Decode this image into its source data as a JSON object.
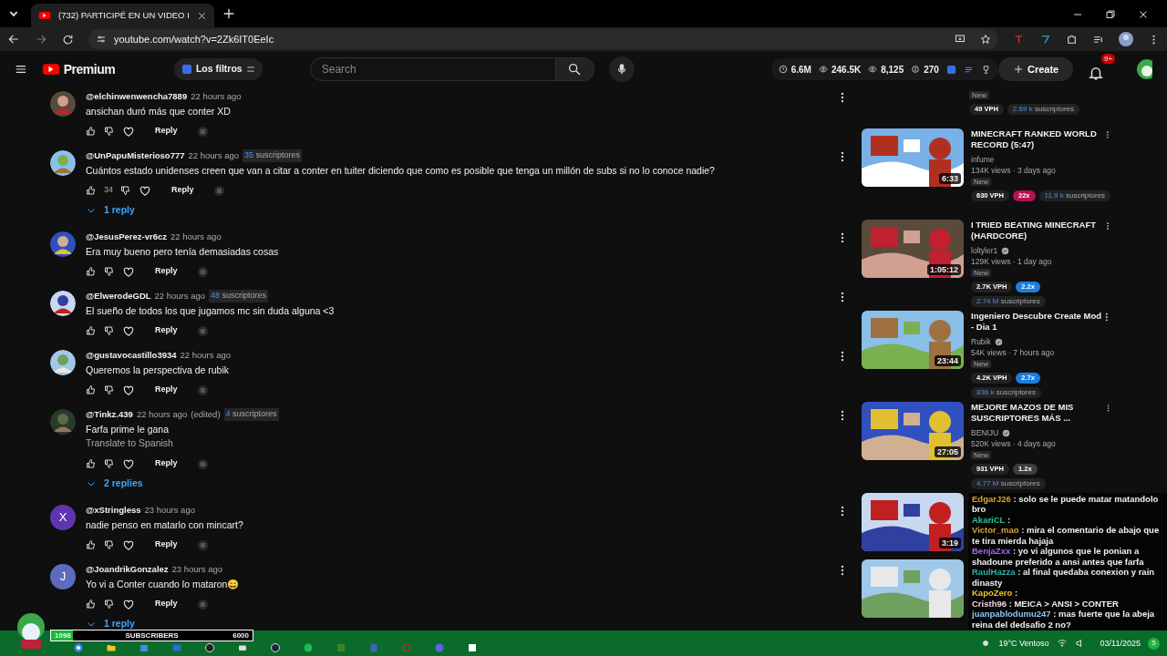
{
  "browser": {
    "tab_title": "(732) PARTICIPÉ EN UN VIDEO I",
    "url": "youtube.com/watch?v=2Zk6IT0EeIc"
  },
  "header": {
    "logo": "Premium",
    "filter_chip": "Los filtros",
    "search": {
      "placeholder": "Search"
    },
    "stats": [
      {
        "kind": "clock",
        "value": "6.6M"
      },
      {
        "kind": "views",
        "value": "246.5K"
      },
      {
        "kind": "views",
        "value": "8,125"
      },
      {
        "kind": "money",
        "value": "270"
      }
    ],
    "create": "Create",
    "notifications": "9+"
  },
  "comments": [
    {
      "author": "@elchinwenwencha7889",
      "time": "22 hours ago",
      "text": "ansichan duró más que conter XD",
      "reply_label": "Reply"
    },
    {
      "author": "@UnPapuMisterioso777",
      "time": "22 hours ago",
      "subscribers": {
        "count": "35",
        "label": "suscriptores"
      },
      "text": "Cuántos estado unidenses creen que van a citar a conter en tuiter diciendo que como es posible que tenga un millón de subs si no lo conoce nadie?",
      "likes": "34",
      "reply_label": "Reply",
      "replies": "1 reply"
    },
    {
      "author": "@JesusPerez-vr6cz",
      "time": "22 hours ago",
      "text": "Era muy bueno pero tenía demasiadas cosas",
      "reply_label": "Reply"
    },
    {
      "author": "@ElwerodeGDL",
      "time": "22 hours ago",
      "subscribers": {
        "count": "48",
        "label": "suscriptores"
      },
      "text": "El sueño de todos los que jugamos mc sin duda alguna <3",
      "reply_label": "Reply"
    },
    {
      "author": "@gustavocastillo3934",
      "time": "22 hours ago",
      "text": "Queremos la perspectiva de rubik",
      "reply_label": "Reply"
    },
    {
      "author": "@Tinkz.439",
      "time": "22 hours ago",
      "edited_label": "(edited)",
      "subscribers": {
        "count": "4",
        "label": "suscriptores"
      },
      "text": "Farfa prime le gana",
      "translate": "Translate to Spanish",
      "reply_label": "Reply",
      "replies": "2 replies"
    },
    {
      "author": "@xStringless",
      "time": "23 hours ago",
      "text": "nadie penso en matarlo con mincart?",
      "reply_label": "Reply",
      "avatar": {
        "kind": "letter",
        "letter": "X",
        "color": "#5e35b1"
      }
    },
    {
      "author": "@JoandrikGonzalez",
      "time": "23 hours ago",
      "text": "Yo vi a Conter cuando lo mataron😄",
      "reply_label": "Reply",
      "replies": "1 reply",
      "avatar": {
        "kind": "letter",
        "letter": "J",
        "color": "#5c6bc0"
      }
    }
  ],
  "sidebar": [
    {
      "kind": "partial",
      "new_label": "New",
      "vph": "49 VPH",
      "subs": {
        "count": "2.69 k",
        "label": "suscriptores"
      }
    },
    {
      "kind": "video",
      "title": "MINECRAFT RANKED WORLD RECORD (5:47)",
      "channel": "infume",
      "verified": false,
      "meta": "134K views · 3 days ago",
      "duration": "6:33",
      "new_label": "New",
      "vph": "630 VPH",
      "multiplier": {
        "text": "22x",
        "color": "#b0134f"
      },
      "subs": {
        "count": "11.9 k",
        "label": "suscriptores"
      }
    },
    {
      "kind": "video",
      "title": "I TRIED BEATING MINECRAFT (HARDCORE)",
      "channel": "loltyler1",
      "verified": true,
      "meta": "129K views · 1 day ago",
      "duration": "1:05:12",
      "new_label": "New",
      "vph": "2.7K VPH",
      "multiplier": {
        "text": "2.2x",
        "color": "#1c7ee0"
      },
      "subs": {
        "count": "2.74 M",
        "label": "suscriptores"
      }
    },
    {
      "kind": "video",
      "title": "Ingeniero Descubre Create Mod - Dia 1",
      "channel": "Rubik",
      "verified": true,
      "meta": "54K views · 7 hours ago",
      "duration": "23:44",
      "new_label": "New",
      "vph": "4.2K VPH",
      "multiplier": {
        "text": "2.7x",
        "color": "#1c7ee0"
      },
      "subs": {
        "count": "836 k",
        "label": "suscriptores"
      }
    },
    {
      "kind": "video",
      "title": "MEJORE MAZOS DE MIS SUSCRIPTORES MÁS ...",
      "channel": "BENIJU",
      "verified": true,
      "meta": "520K views · 4 days ago",
      "duration": "27:05",
      "new_label": "New",
      "vph": "931 VPH",
      "multiplier": {
        "text": "1.2x",
        "color": "#3d3d3d"
      },
      "subs": {
        "count": "4.77 M",
        "label": "suscriptores"
      }
    },
    {
      "kind": "covered",
      "duration": "3:19"
    },
    {
      "kind": "covered"
    }
  ],
  "chat": [
    {
      "user": "EdgarJ26",
      "color": "#e0a030",
      "text": ": solo se le puede matar matandolo bro"
    },
    {
      "user": "AkariCL",
      "color": "#2ec4a0",
      "text": ":"
    },
    {
      "user": "Victor_mao",
      "color": "#d4a63a",
      "text": ": mira el comentario de abajo que te tira mierda hajaja"
    },
    {
      "user": "BenjaZxx",
      "color": "#9b6cf0",
      "text": ": yo vi algunos que le ponian a shadoune preferido a ansi antes que farfa"
    },
    {
      "user": "RaulHazza",
      "color": "#2bb3a8",
      "text": ": al final quedaba conexion y rain dinasty"
    },
    {
      "user": "KapoZero",
      "color": "#f0c020",
      "text": ":"
    },
    {
      "user": "Cristh96",
      "color": "#f2d0e0",
      "text": ": MEICA > ANSI > CONTER"
    },
    {
      "user": "juanpablodumu247",
      "color": "#8fc7f0",
      "text": ": mas fuerte que la abeja reina del dedsafio 2 no?"
    }
  ],
  "sub_goal": {
    "current": "1098",
    "label": "SUBSCRIBERS",
    "goal": "6000",
    "level": 0.11
  },
  "taskbar": {
    "weather": "19°C Ventoso",
    "date": "03/11/2025",
    "notifications": "5"
  }
}
